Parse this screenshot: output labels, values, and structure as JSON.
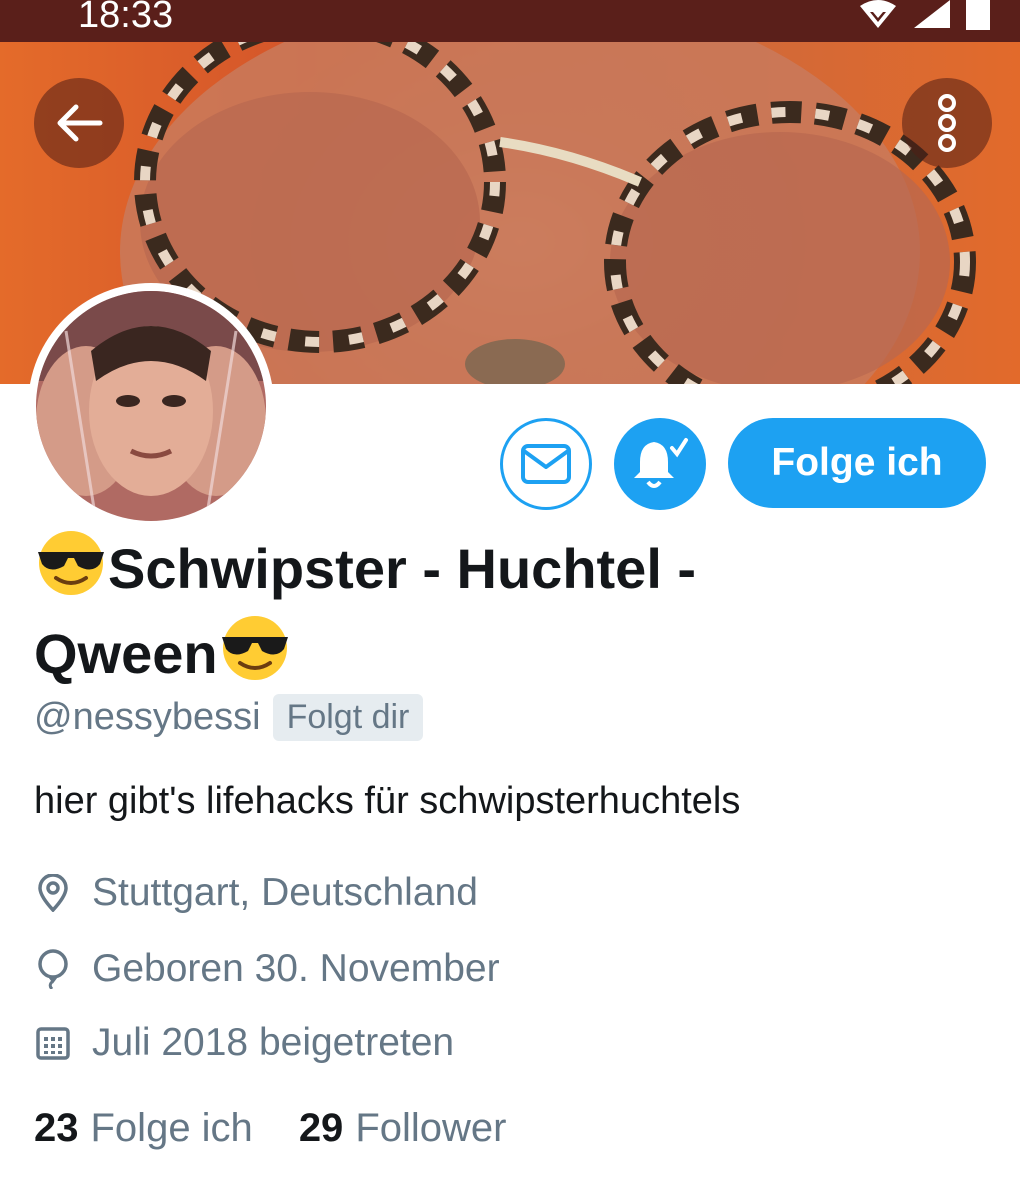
{
  "status_bar": {
    "time": "18:33"
  },
  "profile": {
    "name_parts": [
      "Schwipster - Huchtel -",
      "Qween"
    ],
    "handle": "@nessybessi",
    "follows_you": "Folgt dir",
    "bio": "hier gibt's lifehacks für schwipsterhuchtels",
    "location": "Stuttgart, Deutschland",
    "birthday": "Geboren 30. November",
    "joined": "Juli 2018 beigetreten"
  },
  "actions": {
    "follow_label": "Folge ich"
  },
  "stats": {
    "following_count": "23",
    "following_label": "Folge ich",
    "followers_count": "29",
    "followers_label": "Follower"
  },
  "icons": {
    "back": "arrow-left-icon",
    "more": "more-vertical-icon",
    "message": "envelope-icon",
    "notifications": "bell-check-icon",
    "location": "map-pin-icon",
    "birthday": "balloon-icon",
    "joined": "calendar-icon"
  },
  "colors": {
    "accent": "#1da1f2",
    "muted": "#657786",
    "status_bar": "#5a1f1a"
  }
}
